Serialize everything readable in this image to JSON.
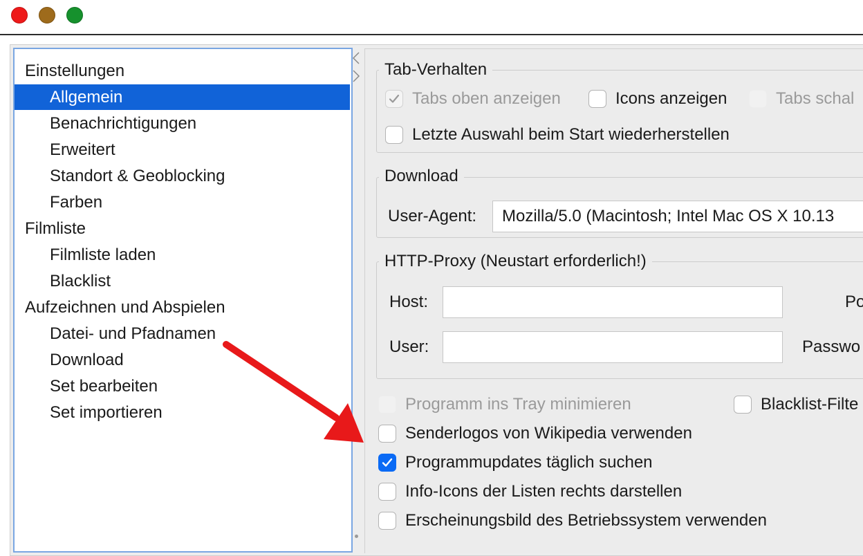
{
  "window": {
    "controls": [
      "close",
      "minimize",
      "maximize"
    ],
    "colors": {
      "close": "#ee1a1a",
      "minimize": "#9e6b1c",
      "maximize": "#16912d"
    }
  },
  "sidebar": {
    "items": [
      {
        "label": "Einstellungen",
        "level": 0
      },
      {
        "label": "Allgemein",
        "level": 1,
        "selected": true
      },
      {
        "label": "Benachrichtigungen",
        "level": 1
      },
      {
        "label": "Erweitert",
        "level": 1
      },
      {
        "label": "Standort & Geoblocking",
        "level": 1
      },
      {
        "label": "Farben",
        "level": 1
      },
      {
        "label": "Filmliste",
        "level": 0
      },
      {
        "label": "Filmliste laden",
        "level": 1
      },
      {
        "label": "Blacklist",
        "level": 1
      },
      {
        "label": "Aufzeichnen und Abspielen",
        "level": 0
      },
      {
        "label": "Datei- und Pfadnamen",
        "level": 1
      },
      {
        "label": "Download",
        "level": 1
      },
      {
        "label": "Set bearbeiten",
        "level": 1
      },
      {
        "label": "Set importieren",
        "level": 1
      }
    ],
    "selected_color": "#1163d8"
  },
  "tab_group": {
    "legend": "Tab-Verhalten",
    "tabs_oben": {
      "label": "Tabs oben anzeigen",
      "checked": true,
      "enabled": false
    },
    "icons": {
      "label": "Icons anzeigen",
      "checked": false
    },
    "tabs_schal": {
      "label": "Tabs schal",
      "checked": false,
      "enabled": false
    },
    "letzte_auswahl": {
      "label": "Letzte Auswahl beim Start wiederherstellen",
      "checked": false
    }
  },
  "download_group": {
    "legend": "Download",
    "user_agent_label": "User-Agent:",
    "user_agent_value": "Mozilla/5.0 (Macintosh; Intel Mac OS X 10.13"
  },
  "proxy_group": {
    "legend": "HTTP-Proxy (Neustart erforderlich!)",
    "host_label": "Host:",
    "host_value": "",
    "port_label": "Po",
    "user_label": "User:",
    "user_value": "",
    "password_label": "Passwo"
  },
  "options": {
    "tray": {
      "label": "Programm ins Tray minimieren",
      "checked": false,
      "enabled": false
    },
    "blacklist_filter": {
      "label": "Blacklist-Filte",
      "checked": false
    },
    "senderlogos": {
      "label": "Senderlogos von Wikipedia verwenden",
      "checked": false
    },
    "updates": {
      "label": "Programmupdates täglich suchen",
      "checked": true
    },
    "info_icons": {
      "label": "Info-Icons der Listen rechts darstellen",
      "checked": false
    },
    "erscheinungsbild": {
      "label": "Erscheinungsbild des Betriebssystem verwenden",
      "checked": false
    }
  },
  "annotation": {
    "type": "arrow",
    "color": "#e8191a",
    "points_to": "Programmupdates täglich suchen"
  },
  "accent_color": "#0a6af5"
}
